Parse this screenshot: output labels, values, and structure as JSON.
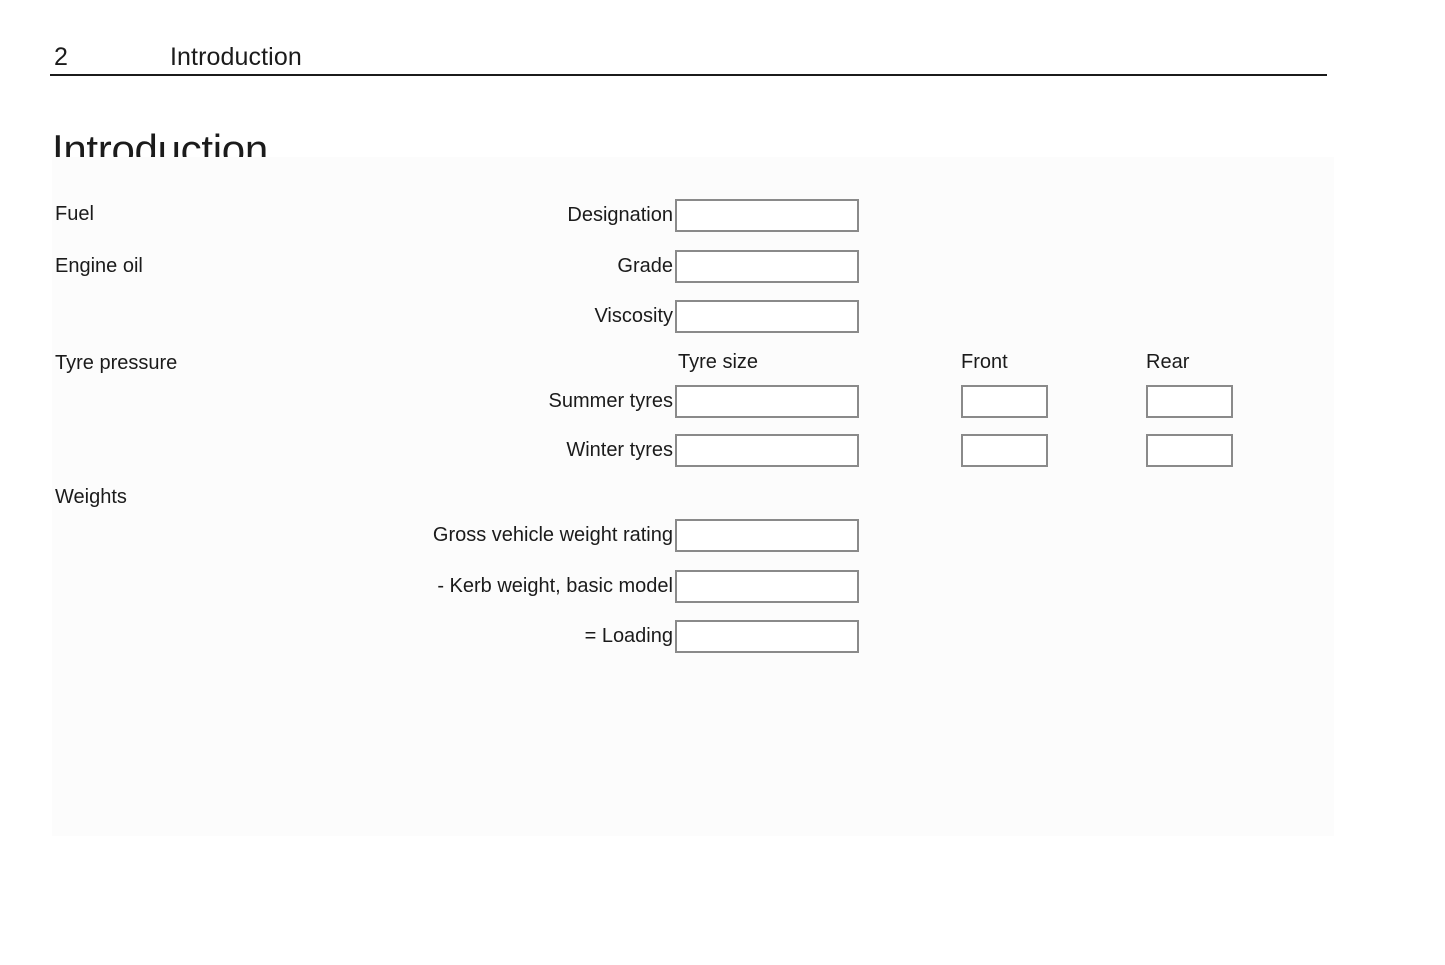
{
  "header": {
    "page_number": "2",
    "chapter": "Introduction"
  },
  "title": "Introduction",
  "sections": {
    "fuel": {
      "heading": "Fuel",
      "rows": [
        {
          "label": "Designation",
          "value": ""
        }
      ]
    },
    "engine_oil": {
      "heading": "Engine oil",
      "rows": [
        {
          "label": "Grade",
          "value": ""
        },
        {
          "label": "Viscosity",
          "value": ""
        }
      ]
    },
    "tyre_pressure": {
      "heading": "Tyre pressure",
      "columns": [
        "Tyre size",
        "Front",
        "Rear"
      ],
      "rows": [
        {
          "label": "Summer tyres",
          "tyre_size": "",
          "front": "",
          "rear": ""
        },
        {
          "label": "Winter tyres",
          "tyre_size": "",
          "front": "",
          "rear": ""
        }
      ]
    },
    "weights": {
      "heading": "Weights",
      "rows": [
        {
          "label": "Gross vehicle weight rating",
          "value": ""
        },
        {
          "label": "- Kerb weight, basic model",
          "value": ""
        },
        {
          "label": "= Loading",
          "value": ""
        }
      ]
    }
  }
}
